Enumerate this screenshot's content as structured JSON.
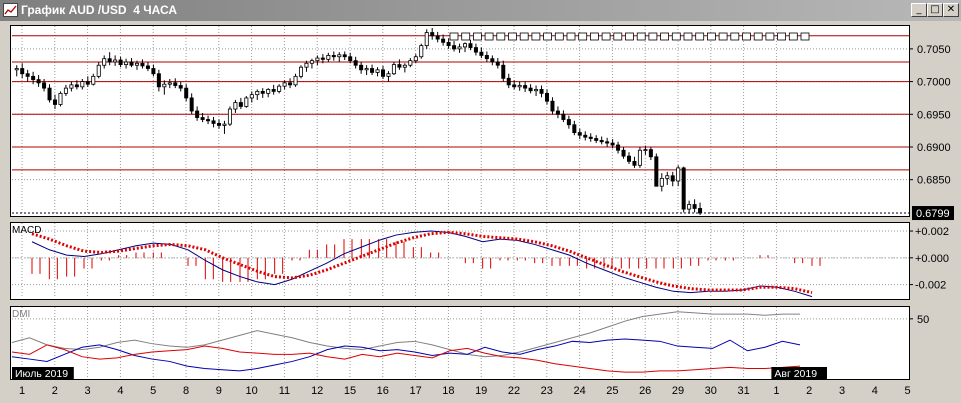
{
  "window": {
    "title": "График AUD /USD  4 ЧАСА",
    "buttons": {
      "minimize": "_",
      "maximize": "□",
      "close": "✕"
    }
  },
  "colors": {
    "background": "#d4d0c8",
    "pane": "#ffffff",
    "candle": "#000000",
    "resistance_lines": "#b00000",
    "macd_line": "#000080",
    "signal_line": "#dd0000",
    "histogram": "#dd0000",
    "dmi_plus": "#0000b0",
    "dmi_minus": "#dd0000",
    "adx": "#808080"
  },
  "chart_data": {
    "type": "candlestick",
    "symbol": "AUD /USD",
    "timeframe": "4 ЧАСА",
    "price_axis": {
      "ylim": [
        0.6796,
        0.7085
      ],
      "ticks": [
        "0.7050",
        "0.7000",
        "0.6950",
        "0.6900",
        "0.6850"
      ],
      "tick_values": [
        0.705,
        0.7,
        0.695,
        0.69,
        0.685
      ],
      "current_price_label": "0.6799",
      "current_price": 0.6799
    },
    "horizontal_lines": [
      0.707,
      0.703,
      0.7,
      0.695,
      0.69,
      0.6865
    ],
    "dotted_line": 0.6799,
    "date_axis": {
      "labels": [
        "1",
        "2",
        "3",
        "4",
        "5",
        "8",
        "9",
        "10",
        "11",
        "12",
        "15",
        "16",
        "17",
        "18",
        "19",
        "22",
        "23",
        "24",
        "25",
        "26",
        "29",
        "30",
        "31",
        "1",
        "2",
        "3",
        "4",
        "5"
      ],
      "month_labels": [
        {
          "text": "Июль 2019",
          "at_day_index": 0
        },
        {
          "text": "Авг 2019",
          "at_day_index": 23
        }
      ]
    },
    "candles_per_day": 6,
    "candles_ohlc": [
      [
        0.7018,
        0.7025,
        0.7008,
        0.702
      ],
      [
        0.702,
        0.7028,
        0.7005,
        0.7012
      ],
      [
        0.7012,
        0.7018,
        0.7,
        0.7008
      ],
      [
        0.7008,
        0.7015,
        0.6996,
        0.7003
      ],
      [
        0.7003,
        0.701,
        0.6992,
        0.6998
      ],
      [
        0.6998,
        0.7004,
        0.6985,
        0.699
      ],
      [
        0.699,
        0.6996,
        0.6968,
        0.6972
      ],
      [
        0.6972,
        0.698,
        0.6958,
        0.6965
      ],
      [
        0.6965,
        0.6985,
        0.6962,
        0.6982
      ],
      [
        0.6982,
        0.6995,
        0.6978,
        0.699
      ],
      [
        0.699,
        0.7,
        0.6985,
        0.6995
      ],
      [
        0.6995,
        0.7002,
        0.6988,
        0.6992
      ],
      [
        0.6992,
        0.7004,
        0.6988,
        0.7
      ],
      [
        0.7,
        0.7008,
        0.6992,
        0.6996
      ],
      [
        0.6996,
        0.7012,
        0.6994,
        0.7008
      ],
      [
        0.7008,
        0.703,
        0.7005,
        0.7025
      ],
      [
        0.7025,
        0.704,
        0.702,
        0.7035
      ],
      [
        0.7035,
        0.7045,
        0.7025,
        0.703
      ],
      [
        0.703,
        0.704,
        0.7024,
        0.7033
      ],
      [
        0.7033,
        0.7038,
        0.7022,
        0.7026
      ],
      [
        0.7026,
        0.7035,
        0.702,
        0.703
      ],
      [
        0.703,
        0.7036,
        0.7022,
        0.7025
      ],
      [
        0.7025,
        0.7032,
        0.7018,
        0.7028
      ],
      [
        0.7028,
        0.7034,
        0.702,
        0.7024
      ],
      [
        0.7024,
        0.703,
        0.7016,
        0.702
      ],
      [
        0.702,
        0.7026,
        0.7008,
        0.7012
      ],
      [
        0.7012,
        0.7018,
        0.6985,
        0.6992
      ],
      [
        0.6992,
        0.7002,
        0.698,
        0.6996
      ],
      [
        0.6996,
        0.7004,
        0.699,
        0.6998
      ],
      [
        0.6998,
        0.7005,
        0.699,
        0.6994
      ],
      [
        0.6994,
        0.7,
        0.6985,
        0.699
      ],
      [
        0.699,
        0.6996,
        0.697,
        0.6975
      ],
      [
        0.6975,
        0.6982,
        0.695,
        0.6955
      ],
      [
        0.6955,
        0.6962,
        0.694,
        0.6945
      ],
      [
        0.6945,
        0.6952,
        0.6938,
        0.6942
      ],
      [
        0.6942,
        0.6948,
        0.6935,
        0.694
      ],
      [
        0.694,
        0.6946,
        0.693,
        0.6936
      ],
      [
        0.6936,
        0.6942,
        0.6928,
        0.6933
      ],
      [
        0.6933,
        0.694,
        0.692,
        0.6935
      ],
      [
        0.6935,
        0.6962,
        0.6932,
        0.6958
      ],
      [
        0.6958,
        0.6972,
        0.6952,
        0.6968
      ],
      [
        0.6968,
        0.6975,
        0.6958,
        0.6962
      ],
      [
        0.6962,
        0.6978,
        0.696,
        0.6975
      ],
      [
        0.6975,
        0.6985,
        0.6968,
        0.698
      ],
      [
        0.698,
        0.6988,
        0.6972,
        0.6985
      ],
      [
        0.6985,
        0.699,
        0.6975,
        0.6982
      ],
      [
        0.6982,
        0.699,
        0.6976,
        0.6988
      ],
      [
        0.6988,
        0.6995,
        0.698,
        0.6985
      ],
      [
        0.6985,
        0.6996,
        0.6982,
        0.6993
      ],
      [
        0.6993,
        0.7002,
        0.6988,
        0.6998
      ],
      [
        0.6998,
        0.7005,
        0.699,
        0.6995
      ],
      [
        0.6995,
        0.7012,
        0.6992,
        0.7008
      ],
      [
        0.7008,
        0.7025,
        0.7005,
        0.7022
      ],
      [
        0.7022,
        0.7032,
        0.7015,
        0.7028
      ],
      [
        0.7028,
        0.7035,
        0.702,
        0.7032
      ],
      [
        0.7032,
        0.704,
        0.7025,
        0.7036
      ],
      [
        0.7036,
        0.7042,
        0.7028,
        0.7034
      ],
      [
        0.7034,
        0.7044,
        0.703,
        0.704
      ],
      [
        0.704,
        0.7046,
        0.7032,
        0.7038
      ],
      [
        0.7038,
        0.7045,
        0.703,
        0.7041
      ],
      [
        0.7041,
        0.7046,
        0.7033,
        0.7038
      ],
      [
        0.7038,
        0.7044,
        0.7028,
        0.7032
      ],
      [
        0.7032,
        0.7038,
        0.702,
        0.7025
      ],
      [
        0.7025,
        0.703,
        0.7012,
        0.7018
      ],
      [
        0.7018,
        0.7025,
        0.701,
        0.702
      ],
      [
        0.702,
        0.7026,
        0.701,
        0.7014
      ],
      [
        0.7014,
        0.7022,
        0.7008,
        0.7018
      ],
      [
        0.7018,
        0.7024,
        0.7004,
        0.7008
      ],
      [
        0.7008,
        0.7016,
        0.7,
        0.7012
      ],
      [
        0.7012,
        0.703,
        0.701,
        0.7026
      ],
      [
        0.7026,
        0.7034,
        0.7018,
        0.7022
      ],
      [
        0.7022,
        0.7028,
        0.7014,
        0.7025
      ],
      [
        0.7025,
        0.7036,
        0.7022,
        0.7032
      ],
      [
        0.7032,
        0.7042,
        0.7028,
        0.7038
      ],
      [
        0.7038,
        0.7058,
        0.7035,
        0.7055
      ],
      [
        0.7055,
        0.708,
        0.705,
        0.7075
      ],
      [
        0.7075,
        0.7082,
        0.7064,
        0.707
      ],
      [
        0.707,
        0.7076,
        0.706,
        0.7065
      ],
      [
        0.7065,
        0.7072,
        0.7055,
        0.706
      ],
      [
        0.706,
        0.7066,
        0.705,
        0.7055
      ],
      [
        0.7055,
        0.7062,
        0.7046,
        0.705
      ],
      [
        0.705,
        0.7058,
        0.7044,
        0.7053
      ],
      [
        0.7053,
        0.706,
        0.7045,
        0.7058
      ],
      [
        0.7058,
        0.7064,
        0.7048,
        0.7052
      ],
      [
        0.7052,
        0.7058,
        0.704,
        0.7045
      ],
      [
        0.7045,
        0.7052,
        0.7036,
        0.704
      ],
      [
        0.704,
        0.7046,
        0.703,
        0.7035
      ],
      [
        0.7035,
        0.704,
        0.7025,
        0.703
      ],
      [
        0.703,
        0.7036,
        0.702,
        0.7025
      ],
      [
        0.7025,
        0.7032,
        0.7,
        0.7005
      ],
      [
        0.7005,
        0.7012,
        0.699,
        0.6995
      ],
      [
        0.6995,
        0.7002,
        0.6988,
        0.6992
      ],
      [
        0.6992,
        0.7,
        0.6986,
        0.6994
      ],
      [
        0.6994,
        0.7,
        0.6984,
        0.699
      ],
      [
        0.699,
        0.6996,
        0.6982,
        0.6986
      ],
      [
        0.6986,
        0.6994,
        0.6978,
        0.6988
      ],
      [
        0.6988,
        0.6994,
        0.6976,
        0.6982
      ],
      [
        0.6982,
        0.6988,
        0.6965,
        0.697
      ],
      [
        0.697,
        0.6976,
        0.695,
        0.6955
      ],
      [
        0.6955,
        0.6962,
        0.6944,
        0.695
      ],
      [
        0.695,
        0.6956,
        0.6938,
        0.6942
      ],
      [
        0.6942,
        0.6948,
        0.6928,
        0.6934
      ],
      [
        0.6934,
        0.694,
        0.6918,
        0.6922
      ],
      [
        0.6922,
        0.6928,
        0.6912,
        0.6918
      ],
      [
        0.6918,
        0.6924,
        0.691,
        0.6915
      ],
      [
        0.6915,
        0.6921,
        0.6908,
        0.6913
      ],
      [
        0.6913,
        0.6918,
        0.6906,
        0.691
      ],
      [
        0.691,
        0.6916,
        0.6904,
        0.6908
      ],
      [
        0.6908,
        0.6914,
        0.69,
        0.6906
      ],
      [
        0.6906,
        0.6912,
        0.6898,
        0.6903
      ],
      [
        0.6903,
        0.6908,
        0.689,
        0.6895
      ],
      [
        0.6895,
        0.69,
        0.6882,
        0.6886
      ],
      [
        0.6886,
        0.6892,
        0.6874,
        0.6878
      ],
      [
        0.6878,
        0.6885,
        0.6868,
        0.6872
      ],
      [
        0.6872,
        0.69,
        0.6868,
        0.6895
      ],
      [
        0.6895,
        0.6902,
        0.6888,
        0.6896
      ],
      [
        0.6896,
        0.69,
        0.688,
        0.6885
      ],
      [
        0.6885,
        0.689,
        0.6855,
        0.684
      ],
      [
        0.684,
        0.686,
        0.6832,
        0.6852
      ],
      [
        0.6852,
        0.6862,
        0.6842,
        0.6856
      ],
      [
        0.6856,
        0.6862,
        0.684,
        0.6848
      ],
      [
        0.6848,
        0.6872,
        0.684,
        0.6868
      ],
      [
        0.6868,
        0.687,
        0.68,
        0.6805
      ],
      [
        0.6805,
        0.6818,
        0.6798,
        0.6812
      ],
      [
        0.6812,
        0.682,
        0.68,
        0.6806
      ],
      [
        0.6806,
        0.6815,
        0.6796,
        0.6799
      ]
    ],
    "macd_panel": {
      "label": "MACD",
      "ticks": [
        "+0.002",
        "+0.000",
        "-0.002"
      ],
      "tick_values": [
        0.002,
        0.0,
        -0.002
      ],
      "ylim": [
        -0.003,
        0.0026
      ],
      "macd": [
        0.0012,
        0.0006,
        0.0002,
        0.0001,
        0.0003,
        0.0006,
        0.0009,
        0.0011,
        0.001,
        0.0006,
        -0.0002,
        -0.0009,
        -0.0014,
        -0.0018,
        -0.002,
        -0.0016,
        -0.001,
        -0.0004,
        0.0003,
        0.0008,
        0.0013,
        0.0017,
        0.0019,
        0.002,
        0.0019,
        0.0016,
        0.0012,
        0.0014,
        0.0013,
        0.001,
        0.0006,
        0.0002,
        -0.0004,
        -0.0009,
        -0.0014,
        -0.0018,
        -0.0022,
        -0.0025,
        -0.0026,
        -0.0025,
        -0.0025,
        -0.0024,
        -0.0021,
        -0.0022,
        -0.0025,
        -0.0029
      ],
      "signal": [
        0.0018,
        0.0014,
        0.0009,
        0.0005,
        0.0004,
        0.0005,
        0.0007,
        0.0009,
        0.001,
        0.0009,
        0.0006,
        0.0,
        -0.0005,
        -0.001,
        -0.0014,
        -0.0015,
        -0.0013,
        -0.0009,
        -0.0004,
        0.0001,
        0.0006,
        0.0011,
        0.0015,
        0.0018,
        0.0019,
        0.0018,
        0.0016,
        0.0015,
        0.0014,
        0.0012,
        0.0009,
        0.0005,
        0.0,
        -0.0005,
        -0.001,
        -0.0014,
        -0.0018,
        -0.0021,
        -0.0023,
        -0.0024,
        -0.0024,
        -0.0024,
        -0.0022,
        -0.0022,
        -0.0023,
        -0.0026
      ]
    },
    "dmi_panel": {
      "label": "DMI",
      "ticks": [
        "50"
      ],
      "tick_values": [
        50
      ],
      "ylim": [
        0,
        60
      ],
      "adx": [
        30,
        34,
        28,
        25,
        24,
        26,
        30,
        32,
        29,
        27,
        26,
        28,
        32,
        36,
        40,
        37,
        34,
        30,
        27,
        25,
        24,
        27,
        30,
        31,
        28,
        24,
        20,
        18,
        19,
        22,
        26,
        30,
        34,
        38,
        43,
        48,
        52,
        54,
        56,
        55,
        54,
        54,
        54,
        53,
        54,
        54
      ],
      "di_plus": [
        18,
        16,
        14,
        20,
        26,
        28,
        24,
        19,
        16,
        14,
        10,
        8,
        7,
        6,
        8,
        11,
        14,
        18,
        24,
        27,
        26,
        23,
        24,
        22,
        19,
        21,
        20,
        26,
        22,
        20,
        24,
        27,
        31,
        30,
        32,
        33,
        32,
        31,
        27,
        26,
        25,
        32,
        23,
        26,
        31,
        28
      ],
      "di_minus": [
        22,
        20,
        28,
        24,
        18,
        16,
        17,
        20,
        22,
        23,
        24,
        27,
        25,
        22,
        21,
        20,
        20,
        21,
        18,
        16,
        20,
        18,
        21,
        19,
        17,
        23,
        25,
        21,
        18,
        17,
        15,
        12,
        10,
        8,
        6,
        5,
        5,
        6,
        6,
        7,
        8,
        9,
        8,
        8,
        9,
        10
      ]
    }
  }
}
